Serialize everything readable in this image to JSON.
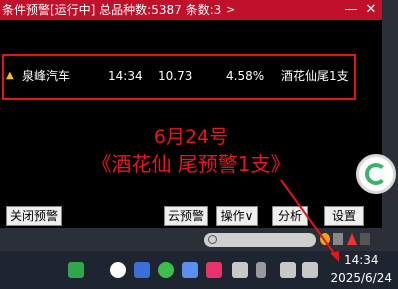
{
  "titlebar": {
    "title": "条件预警[运行中] 总品种数:5387 条数:3",
    "menu_arrow": ">",
    "minimize": "—",
    "close": "✕"
  },
  "alert_row": {
    "arrow": "▲",
    "name": "泉峰汽车",
    "time": "14:34",
    "price": "10.73",
    "change": "4.58%",
    "tag": "酒花仙尾1支"
  },
  "overlay": {
    "date": "6月24号",
    "note": "《酒花仙  尾预警1支》"
  },
  "buttons": {
    "close_alert": "关闭预警",
    "cloud_alert": "云预警",
    "operate": "操作∨",
    "analyze": "分析",
    "settings": "设置"
  },
  "taskbar": {
    "time": "14:34",
    "date": "2025/6/24"
  },
  "colors": {
    "titlebar": "#c0102a",
    "highlight": "#e3141b",
    "brand_green": "#3cb36a"
  }
}
